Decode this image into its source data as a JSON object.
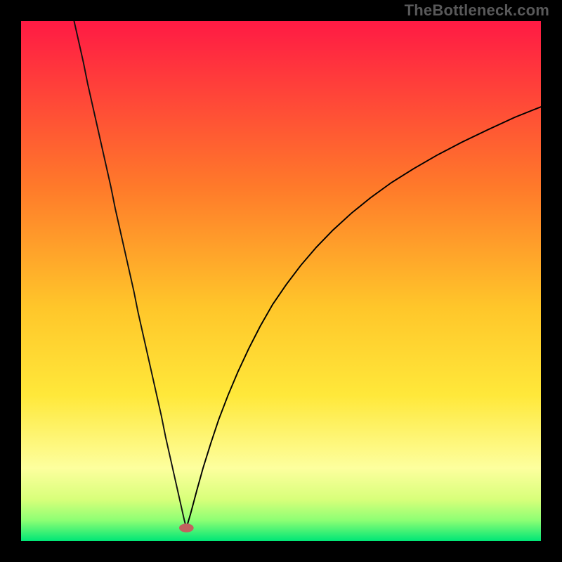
{
  "watermark": "TheBottleneck.com",
  "colors": {
    "background_black": "#000000",
    "gradient_top": "#ff1a44",
    "gradient_upper_mid": "#ff7a2a",
    "gradient_mid": "#ffc62a",
    "gradient_lower_mid": "#ffe83a",
    "gradient_pale": "#fdff9e",
    "gradient_green1": "#d8ff7a",
    "gradient_green2": "#8eff74",
    "gradient_bottom": "#00e676",
    "curve_left": "#111111",
    "curve_right": "#000000",
    "marker": "#c1625f",
    "watermark_text": "#59595a"
  },
  "chart_data": {
    "type": "line",
    "title": "",
    "xlabel": "",
    "ylabel": "",
    "xlim": [
      0,
      100
    ],
    "ylim": [
      0,
      100
    ],
    "legend": [],
    "annotations": [],
    "gradient_stops": [
      {
        "offset": 0.0,
        "color": "#ff1a44"
      },
      {
        "offset": 0.32,
        "color": "#ff7a2a"
      },
      {
        "offset": 0.55,
        "color": "#ffc62a"
      },
      {
        "offset": 0.72,
        "color": "#ffe83a"
      },
      {
        "offset": 0.86,
        "color": "#fdff9e"
      },
      {
        "offset": 0.92,
        "color": "#d8ff7a"
      },
      {
        "offset": 0.96,
        "color": "#8eff74"
      },
      {
        "offset": 1.0,
        "color": "#00e676"
      }
    ],
    "marker": {
      "x": 31.8,
      "y": 2.5
    },
    "series": [
      {
        "name": "left-branch",
        "color": "#111111",
        "points": [
          {
            "x": 10.2,
            "y": 100.0
          },
          {
            "x": 11.1,
            "y": 96.0
          },
          {
            "x": 12.0,
            "y": 92.0
          },
          {
            "x": 12.8,
            "y": 88.0
          },
          {
            "x": 13.7,
            "y": 84.0
          },
          {
            "x": 14.6,
            "y": 80.0
          },
          {
            "x": 15.5,
            "y": 76.0
          },
          {
            "x": 16.4,
            "y": 72.0
          },
          {
            "x": 17.3,
            "y": 68.0
          },
          {
            "x": 18.1,
            "y": 64.0
          },
          {
            "x": 19.0,
            "y": 60.0
          },
          {
            "x": 19.9,
            "y": 56.0
          },
          {
            "x": 20.8,
            "y": 52.0
          },
          {
            "x": 21.7,
            "y": 48.0
          },
          {
            "x": 22.5,
            "y": 44.0
          },
          {
            "x": 23.4,
            "y": 40.0
          },
          {
            "x": 24.3,
            "y": 36.0
          },
          {
            "x": 25.2,
            "y": 32.0
          },
          {
            "x": 26.1,
            "y": 28.0
          },
          {
            "x": 27.0,
            "y": 24.0
          },
          {
            "x": 27.8,
            "y": 20.0
          },
          {
            "x": 28.7,
            "y": 16.0
          },
          {
            "x": 29.6,
            "y": 12.0
          },
          {
            "x": 30.5,
            "y": 8.0
          },
          {
            "x": 31.4,
            "y": 4.0
          },
          {
            "x": 31.8,
            "y": 2.5
          }
        ]
      },
      {
        "name": "right-branch",
        "color": "#000000",
        "points": [
          {
            "x": 31.8,
            "y": 2.5
          },
          {
            "x": 32.6,
            "y": 5.2
          },
          {
            "x": 33.8,
            "y": 9.7
          },
          {
            "x": 35.0,
            "y": 14.0
          },
          {
            "x": 36.5,
            "y": 18.8
          },
          {
            "x": 38.0,
            "y": 23.3
          },
          {
            "x": 39.8,
            "y": 28.0
          },
          {
            "x": 41.7,
            "y": 32.5
          },
          {
            "x": 43.8,
            "y": 37.0
          },
          {
            "x": 46.0,
            "y": 41.3
          },
          {
            "x": 48.4,
            "y": 45.5
          },
          {
            "x": 51.0,
            "y": 49.3
          },
          {
            "x": 53.8,
            "y": 53.0
          },
          {
            "x": 56.8,
            "y": 56.5
          },
          {
            "x": 60.0,
            "y": 59.8
          },
          {
            "x": 63.5,
            "y": 63.0
          },
          {
            "x": 67.2,
            "y": 66.0
          },
          {
            "x": 71.2,
            "y": 68.9
          },
          {
            "x": 75.5,
            "y": 71.6
          },
          {
            "x": 80.0,
            "y": 74.2
          },
          {
            "x": 84.8,
            "y": 76.7
          },
          {
            "x": 89.8,
            "y": 79.1
          },
          {
            "x": 95.0,
            "y": 81.5
          },
          {
            "x": 100.0,
            "y": 83.5
          }
        ]
      }
    ]
  }
}
